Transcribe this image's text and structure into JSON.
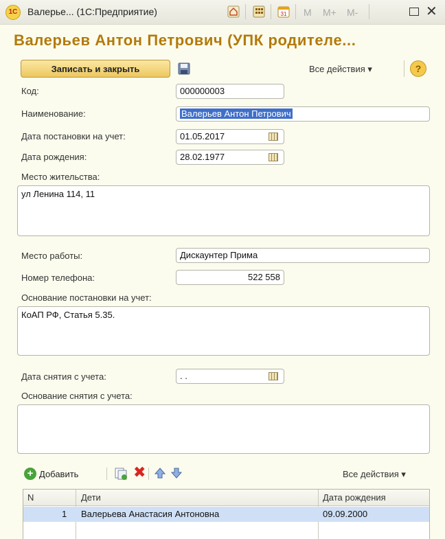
{
  "window": {
    "title": "Валерье... (1С:Предприятие)",
    "logo_text": "1C",
    "memory": [
      "M",
      "M+",
      "M-"
    ]
  },
  "form": {
    "title": "Валерьев Антон Петрович (УПК родителе...",
    "save_close_label": "Записать и закрыть",
    "all_actions_label": "Все действия ▾",
    "help_label": "?"
  },
  "fields": {
    "code": {
      "label": "Код:",
      "value": "000000003"
    },
    "name": {
      "label": "Наименование:",
      "value": "Валерьев Антон Петрович"
    },
    "registration_date": {
      "label": "Дата постановки на учет:",
      "value": "01.05.2017"
    },
    "birth_date": {
      "label": "Дата рождения:",
      "value": "28.02.1977"
    },
    "residence": {
      "label": "Место жительства:",
      "value": "ул Ленина 114, 11"
    },
    "workplace": {
      "label": "Место работы:",
      "value": "Дискаунтер Прима"
    },
    "phone": {
      "label": "Номер телефона:",
      "value": "522 558"
    },
    "registration_basis": {
      "label": "Основание постановки на учет:",
      "value": "КоАП РФ, Статья 5.35."
    },
    "deregistration_date": {
      "label": "Дата снятия с учета:",
      "value": " .  . "
    },
    "deregistration_basis": {
      "label": "Основание снятия с учета:",
      "value": ""
    }
  },
  "children_table": {
    "add_label": "Добавить",
    "all_actions_label": "Все действия ▾",
    "columns": [
      "N",
      "Дети",
      "Дата рождения"
    ],
    "rows": [
      {
        "n": "1",
        "child": "Валерьева Анастасия Антоновна",
        "birth_date": "09.09.2000"
      }
    ]
  },
  "colors": {
    "title": "#b37a0a",
    "background": "#fbfcee",
    "selection": "#3f6fc8",
    "row_highlight": "#cfe0f6"
  }
}
